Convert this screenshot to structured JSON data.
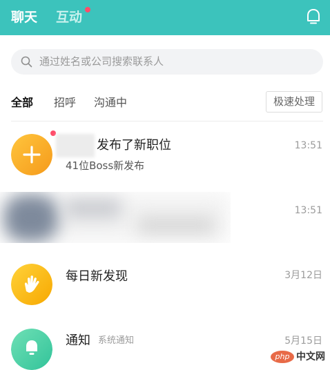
{
  "header": {
    "tabs": [
      {
        "label": "聊天"
      },
      {
        "label": "互动"
      }
    ],
    "bell_icon": "bell-icon",
    "accent_color": "#3cc3bc",
    "dot_color": "#ff4d6a"
  },
  "search": {
    "placeholder": "通过姓名或公司搜索联系人",
    "icon": "search-icon"
  },
  "filter": {
    "tabs": [
      {
        "label": "全部"
      },
      {
        "label": "招呼"
      },
      {
        "label": "沟通中"
      }
    ],
    "quick_button": "极速处理"
  },
  "list": [
    {
      "title": "发布了新职位",
      "subtitle": "41位Boss新发布",
      "time": "13:51",
      "icon": "plus-icon",
      "avatar_color": "#f7a623"
    },
    {
      "time": "13:51"
    },
    {
      "title": "每日新发现",
      "time": "3月12日",
      "icon": "hand-icon",
      "avatar_color": "#f7b500"
    },
    {
      "title": "通知",
      "tag": "系统通知",
      "time": "5月15日",
      "icon": "bell-icon",
      "avatar_color": "#4fd1a7"
    }
  ],
  "watermark": {
    "logo": "php",
    "text": "中文网"
  }
}
